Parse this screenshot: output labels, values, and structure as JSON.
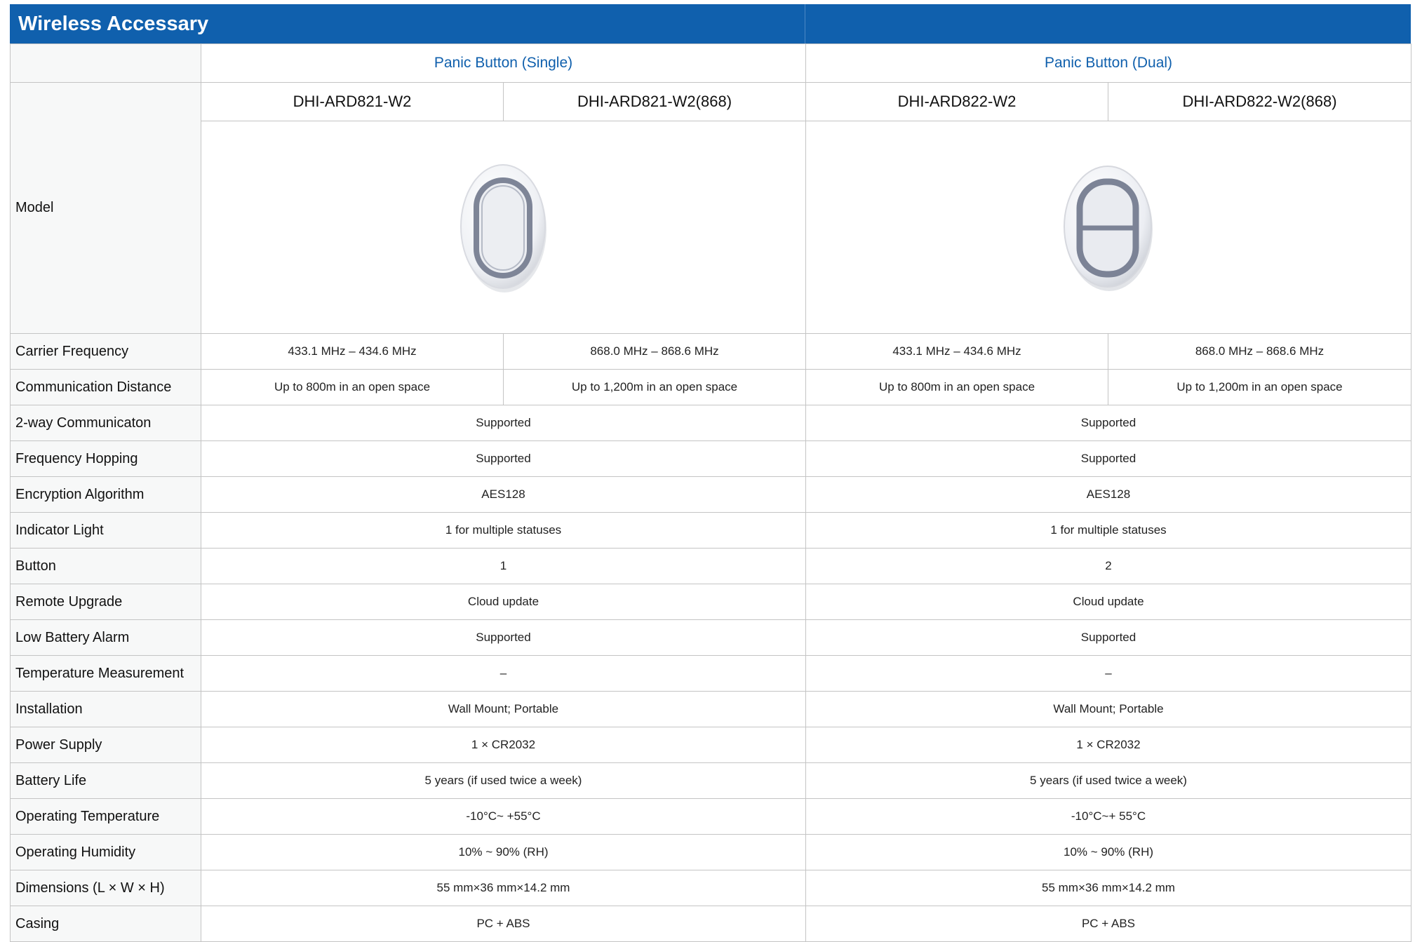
{
  "title": "Wireless Accessary",
  "groups": [
    "Panic Button (Single)",
    "Panic Button (Dual)"
  ],
  "model_label": "Model",
  "models": [
    "DHI-ARD821-W2",
    "DHI-ARD821-W2(868)",
    "DHI-ARD822-W2",
    "DHI-ARD822-W2(868)"
  ],
  "images": [
    "panic-button-single-image",
    "panic-button-dual-image"
  ],
  "rows_split": [
    {
      "label": "Carrier Frequency",
      "values": [
        "433.1 MHz – 434.6 MHz",
        "868.0 MHz – 868.6 MHz",
        "433.1 MHz – 434.6 MHz",
        "868.0 MHz – 868.6 MHz"
      ]
    },
    {
      "label": "Communication Distance",
      "values": [
        "Up to 800m in an open space",
        "Up to 1,200m in an open space",
        "Up to 800m in an open space",
        "Up to 1,200m in an open space"
      ]
    }
  ],
  "rows_merged": [
    {
      "label": "2-way Communicaton",
      "values": [
        "Supported",
        "Supported"
      ]
    },
    {
      "label": "Frequency Hopping",
      "values": [
        "Supported",
        "Supported"
      ]
    },
    {
      "label": "Encryption Algorithm",
      "values": [
        "AES128",
        "AES128"
      ]
    },
    {
      "label": "Indicator Light",
      "values": [
        "1 for multiple statuses",
        "1 for multiple statuses"
      ]
    },
    {
      "label": "Button",
      "values": [
        "1",
        "2"
      ]
    },
    {
      "label": "Remote Upgrade",
      "values": [
        "Cloud update",
        "Cloud update"
      ]
    },
    {
      "label": "Low Battery Alarm",
      "values": [
        "Supported",
        "Supported"
      ]
    },
    {
      "label": "Temperature Measurement",
      "values": [
        "–",
        "–"
      ]
    },
    {
      "label": "Installation",
      "values": [
        "Wall Mount; Portable",
        "Wall Mount; Portable"
      ]
    },
    {
      "label": "Power Supply",
      "values": [
        "1 × CR2032",
        "1 × CR2032"
      ]
    },
    {
      "label": "Battery Life",
      "values": [
        "5 years (if used twice a week)",
        "5 years (if used twice a week)"
      ]
    },
    {
      "label": "Operating Temperature",
      "values": [
        "-10°C~ +55°C",
        "-10°C~+ 55°C"
      ]
    },
    {
      "label": "Operating Humidity",
      "values": [
        "10% ~ 90% (RH)",
        "10% ~ 90% (RH)"
      ]
    },
    {
      "label": "Dimensions (L × W × H)",
      "values": [
        "55 mm×36 mm×14.2 mm",
        "55 mm×36 mm×14.2 mm"
      ]
    },
    {
      "label": "Casing",
      "values": [
        "PC + ABS",
        "PC + ABS"
      ]
    }
  ],
  "colors": {
    "header_blue": "#1060ad",
    "label_bg": "#f7f8f8",
    "border": "#c4c4c4"
  }
}
